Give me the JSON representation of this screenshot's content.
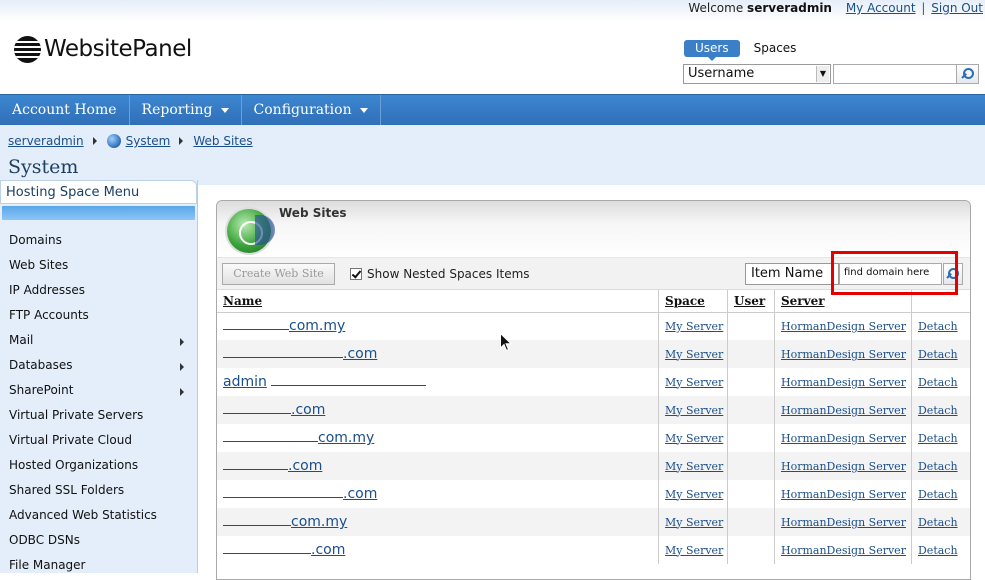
{
  "header": {
    "welcome": "Welcome",
    "username": "serveradmin",
    "my_account": "My Account",
    "separator": "|",
    "sign_out": "Sign Out",
    "logo_text": "WebsitePanel",
    "tabs": [
      "Users",
      "Spaces"
    ],
    "search": {
      "field": "Username",
      "value": ""
    }
  },
  "nav": [
    "Account Home",
    "Reporting",
    "Configuration"
  ],
  "breadcrumb": [
    "serveradmin",
    "System",
    "Web Sites"
  ],
  "page_title": "System",
  "left_menu": {
    "title": "Hosting Space Menu",
    "items": [
      "Domains",
      "Web Sites",
      "IP Addresses",
      "FTP Accounts",
      "Mail",
      "Databases",
      "SharePoint",
      "Virtual Private Servers",
      "Virtual Private Cloud",
      "Hosted Organizations",
      "Shared SSL Folders",
      "Advanced Web Statistics",
      "ODBC DSNs",
      "File Manager"
    ]
  },
  "panel": {
    "title": "Web Sites",
    "create_button": "Create Web Site",
    "nested_label": "Show Nested Spaces Items",
    "nested_checked": true,
    "filter_field": "Item Name",
    "find_value": "find domain here",
    "columns": [
      "Name",
      "Space",
      "User",
      "Server",
      ""
    ],
    "rows": [
      {
        "name": "com.my",
        "space": "My Server",
        "user": "",
        "server": "HormanDesign Server",
        "action": "Detach"
      },
      {
        "name": ".com",
        "space": "My Server",
        "user": "",
        "server": "HormanDesign Server",
        "action": "Detach"
      },
      {
        "name": "admin",
        "space": "My Server",
        "user": "",
        "server": "HormanDesign Server",
        "action": "Detach"
      },
      {
        "name": ".com",
        "space": "My Server",
        "user": "",
        "server": "HormanDesign Server",
        "action": "Detach"
      },
      {
        "name": "com.my",
        "space": "My Server",
        "user": "",
        "server": "HormanDesign Server",
        "action": "Detach"
      },
      {
        "name": ".com",
        "space": "My Server",
        "user": "",
        "server": "HormanDesign Server",
        "action": "Detach"
      },
      {
        "name": ".com",
        "space": "My Server",
        "user": "",
        "server": "HormanDesign Server",
        "action": "Detach"
      },
      {
        "name": "com.my",
        "space": "My Server",
        "user": "",
        "server": "HormanDesign Server",
        "action": "Detach"
      },
      {
        "name": ".com",
        "space": "My Server",
        "user": "",
        "server": "HormanDesign Server",
        "action": "Detach"
      }
    ]
  }
}
